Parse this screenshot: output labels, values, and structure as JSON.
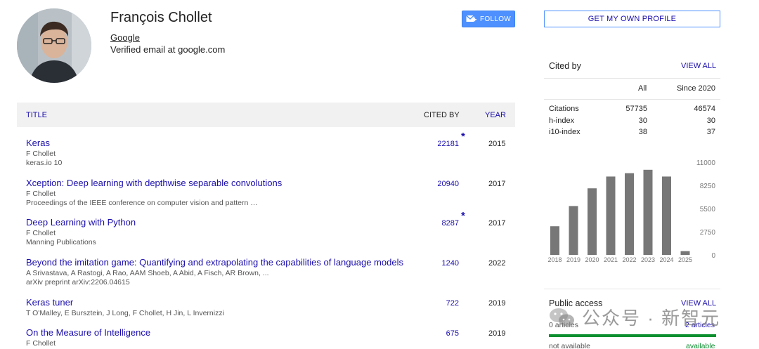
{
  "profile": {
    "name": "François Chollet",
    "affiliation": "Google",
    "email": "Verified email at google.com",
    "follow_label": "FOLLOW"
  },
  "table": {
    "headers": {
      "title": "TITLE",
      "cited_by": "CITED BY",
      "year": "YEAR"
    },
    "rows": [
      {
        "title": "Keras",
        "authors": "F Chollet",
        "venue": "keras.io 10",
        "cited": "22181",
        "star": "*",
        "year": "2015"
      },
      {
        "title": "Xception: Deep learning with depthwise separable convolutions",
        "authors": "F Chollet",
        "venue": "Proceedings of the IEEE conference on computer vision and pattern …",
        "cited": "20940",
        "star": "",
        "year": "2017"
      },
      {
        "title": "Deep Learning with Python",
        "authors": "F Chollet",
        "venue": "Manning Publications",
        "cited": "8287",
        "star": "*",
        "year": "2017"
      },
      {
        "title": "Beyond the imitation game: Quantifying and extrapolating the capabilities of language models",
        "authors": "A Srivastava, A Rastogi, A Rao, AAM Shoeb, A Abid, A Fisch, AR Brown, ...",
        "venue": "arXiv preprint arXiv:2206.04615",
        "cited": "1240",
        "star": "",
        "year": "2022"
      },
      {
        "title": "Keras tuner",
        "authors": "T O'Malley, E Bursztein, J Long, F Chollet, H Jin, L Invernizzi",
        "venue": "",
        "cited": "722",
        "star": "",
        "year": "2019"
      },
      {
        "title": "On the Measure of Intelligence",
        "authors": "F Chollet",
        "venue": "",
        "cited": "675",
        "star": "",
        "year": "2019"
      }
    ]
  },
  "sidebar": {
    "own_profile_label": "GET MY OWN PROFILE",
    "cited_by": {
      "title": "Cited by",
      "view_all": "VIEW ALL",
      "col_all": "All",
      "col_since": "Since 2020",
      "rows": [
        {
          "label": "Citations",
          "all": "57735",
          "since": "46574"
        },
        {
          "label": "h-index",
          "all": "30",
          "since": "30"
        },
        {
          "label": "i10-index",
          "all": "38",
          "since": "37"
        }
      ]
    },
    "public_access": {
      "title": "Public access",
      "view_all": "VIEW ALL",
      "left_count": "0 articles",
      "right_count": "2 articles",
      "not_available": "not available",
      "available": "available"
    }
  },
  "chart_data": {
    "type": "bar",
    "categories": [
      "2018",
      "2019",
      "2020",
      "2021",
      "2022",
      "2023",
      "2024",
      "2025"
    ],
    "values": [
      3400,
      5800,
      7900,
      9300,
      9700,
      10100,
      9300,
      450
    ],
    "ylim": [
      0,
      11000
    ],
    "yticks": [
      "11000",
      "8250",
      "5500",
      "2750",
      "0"
    ],
    "bar_color": "#777777"
  },
  "watermark": {
    "text": "公众号 · 新智元"
  }
}
